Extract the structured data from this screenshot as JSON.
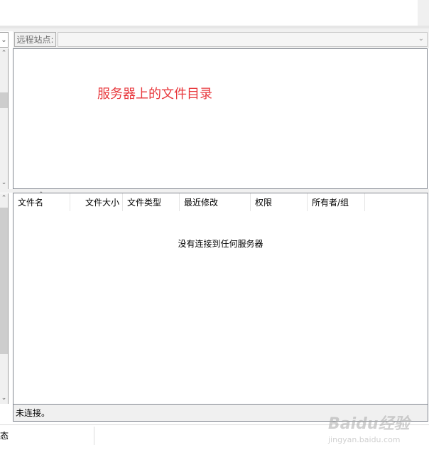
{
  "remote_site": {
    "label": "远程站点:",
    "path": ""
  },
  "remote_tree": {
    "annotation": "服务器上的文件目录"
  },
  "remote_list": {
    "columns": [
      "文件名",
      "文件大小",
      "文件类型",
      "最近修改",
      "权限",
      "所有者/组"
    ],
    "empty_message": "没有连接到任何服务器",
    "status": "未连接。"
  },
  "app_status": {
    "text": "态"
  },
  "icons": {
    "combo_arrow": "chevron-down-icon",
    "scroll_up": "scroll-up-icon",
    "scroll_down": "scroll-down-icon",
    "sort_indicator": "sort-ascending-icon"
  },
  "watermark": {
    "logo": "Baidu经验",
    "url": "jingyan.baidu.com"
  },
  "colors": {
    "annotation": "#e8383d",
    "panel_bg": "#f0f0f0",
    "border": "#828790"
  }
}
